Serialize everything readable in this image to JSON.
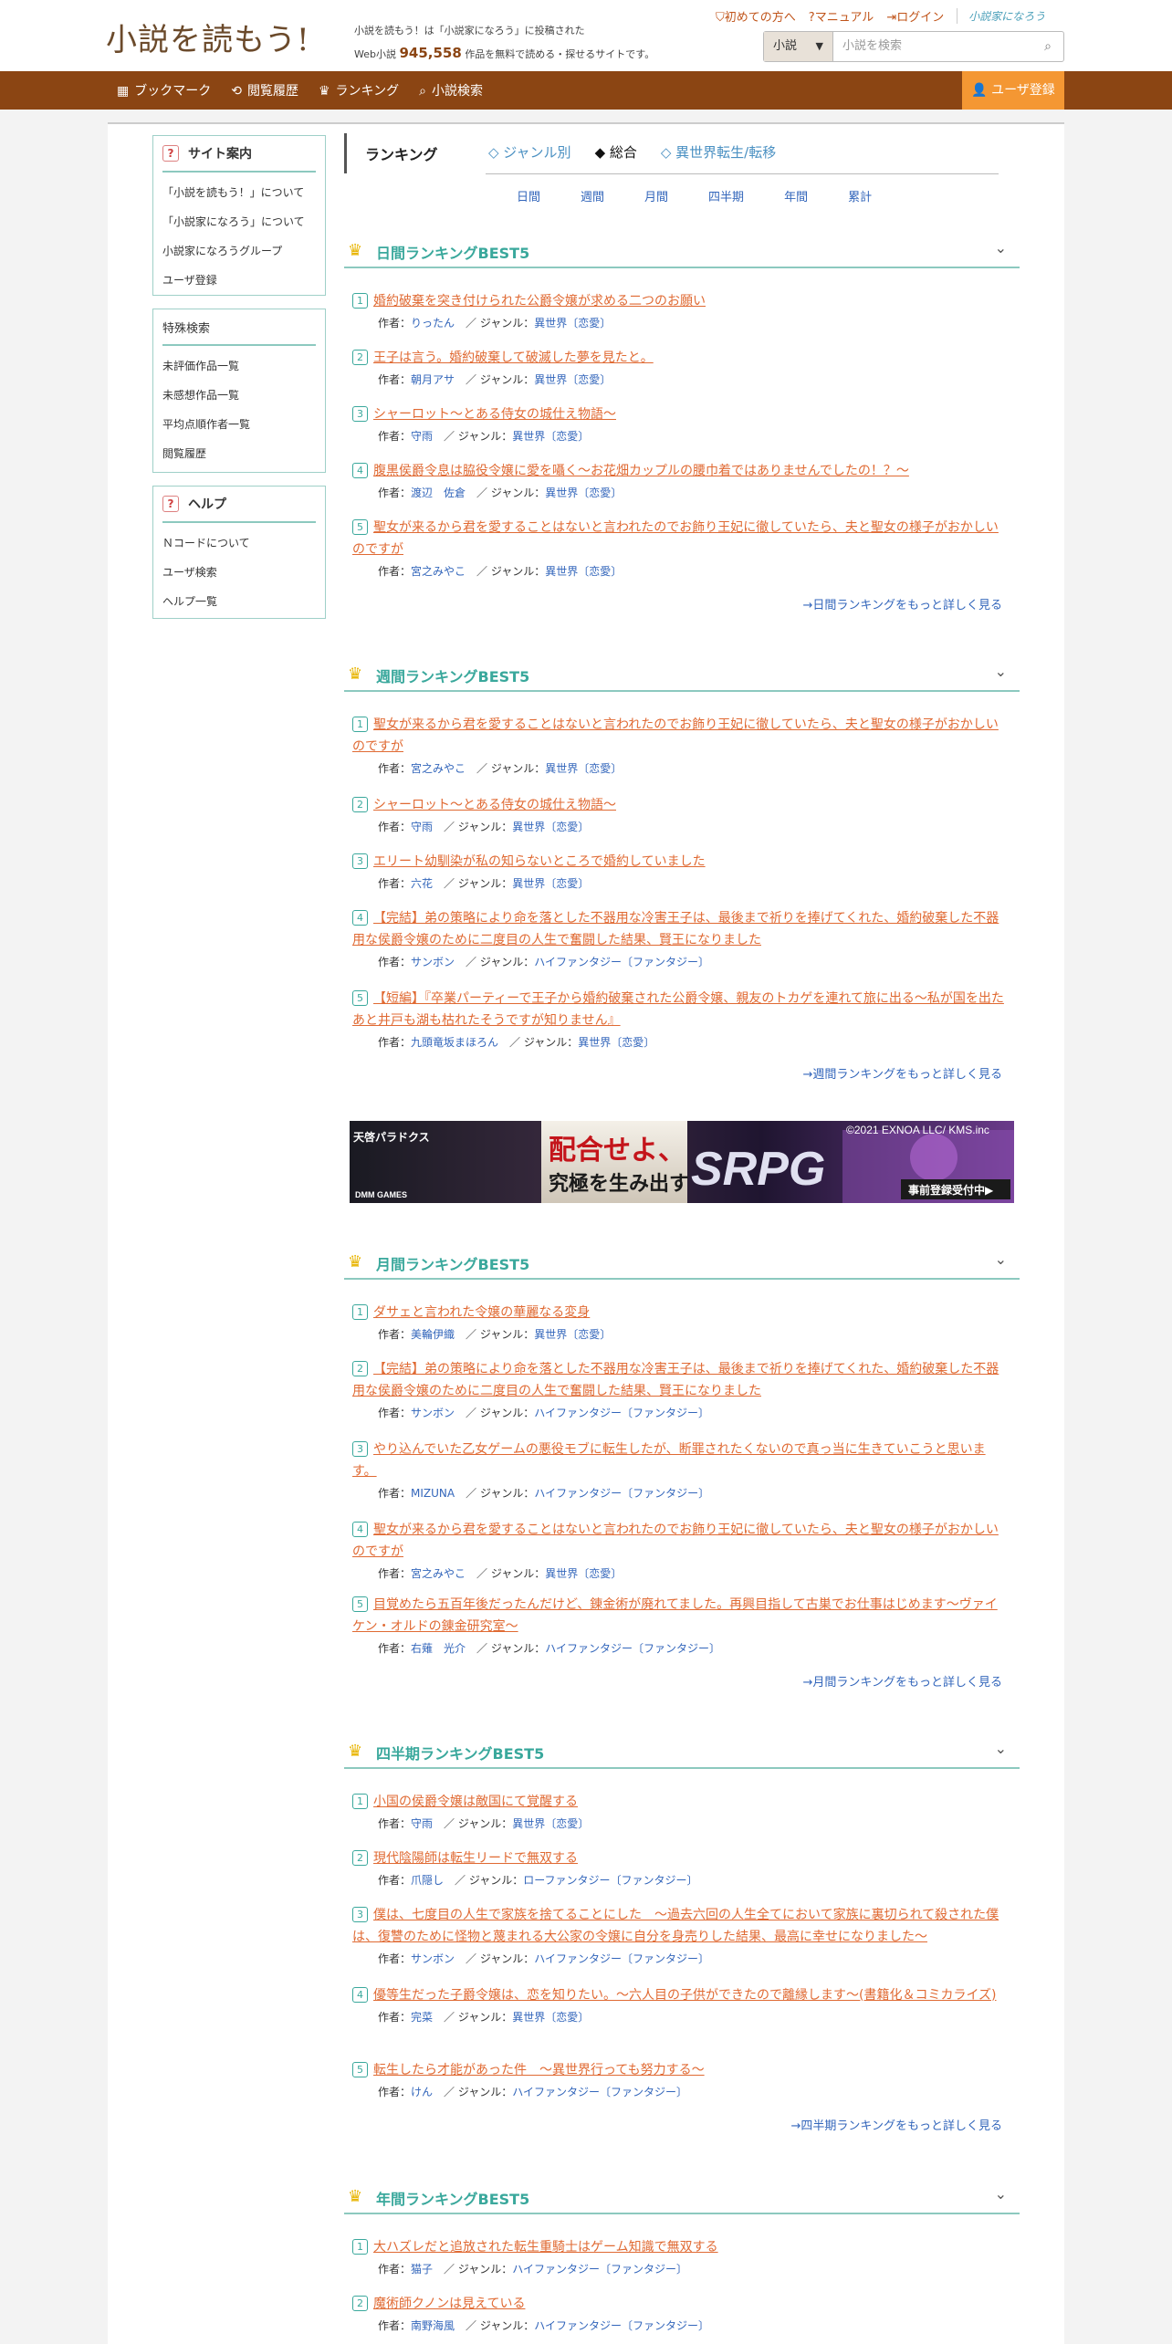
{
  "header": {
    "logo": "小説を読もう!",
    "tagline_line1": "小説を読もう！は「小説家になろう」に投稿された",
    "tagline_pre": "Web小説",
    "tagline_count": "945,558",
    "tagline_post": "作品を無料で読める・探せるサイトです。",
    "links": [
      {
        "icon": "⛉",
        "label": "初めての方へ"
      },
      {
        "icon": "?",
        "label": "マニュアル"
      },
      {
        "icon": "⇥",
        "label": "ログイン"
      }
    ],
    "narou_logo": "小説家になろう",
    "search": {
      "select": "小説",
      "placeholder": "小説を検索"
    }
  },
  "nav": {
    "items": [
      {
        "icon": "▦",
        "label": "ブックマーク"
      },
      {
        "icon": "⟲",
        "label": "閲覧履歴"
      },
      {
        "icon": "♛",
        "label": "ランキング"
      },
      {
        "icon": "⌕",
        "label": "小説検索"
      }
    ],
    "register": "ユーザ登録"
  },
  "sidebar": {
    "guide_title": "サイト案内",
    "guide_items": [
      "「小説を読もう！」について",
      "「小説家になろう」について",
      "小説家になろうグループ",
      "ユーザ登録"
    ],
    "special_title": "特殊検索",
    "special_items": [
      "未評価作品一覧",
      "未感想作品一覧",
      "平均点順作者一覧",
      "閲覧履歴"
    ],
    "help_title": "ヘルプ",
    "help_items": [
      "Ｎコードについて",
      "ユーザ検索",
      "ヘルプ一覧"
    ]
  },
  "main": {
    "title": "ランキング",
    "tabs": [
      "◇ ジャンル別",
      "◆ 総合",
      "◇ 異世界転生/転移"
    ],
    "periods": [
      "日間",
      "週間",
      "月間",
      "四半期",
      "年間",
      "累計"
    ]
  },
  "labels": {
    "author": "作者：",
    "genre": "／ ジャンル："
  },
  "banner": {
    "copyright": "©2021 EXNOA LLC/ KMS.inc",
    "game": "天啓パラドクス",
    "line1": "配合せよ、",
    "line2": "究極を生み出す",
    "srpg": "SRPG",
    "badge": "事前登録受付中▶",
    "brand": "DMM GAMES"
  },
  "rankings": [
    {
      "title": "日間ランキングBEST5",
      "more": "→日間ランキングをもっと詳しく見る",
      "entries": [
        {
          "title": "婚約破棄を突き付けられた公爵令嬢が求める二つのお願い",
          "author": "りったん",
          "genre": "異世界〔恋愛〕"
        },
        {
          "title": "王子は言う。婚約破棄して破滅した夢を見たと。",
          "author": "朝月アサ",
          "genre": "異世界〔恋愛〕"
        },
        {
          "title": "シャーロット〜とある侍女の城仕え物語〜",
          "author": "守雨",
          "genre": "異世界〔恋愛〕"
        },
        {
          "title": "腹黒侯爵令息は脇役令嬢に愛を囁く～お花畑カップルの腰巾着ではありませんでしたの！？～",
          "author": "渡辺　佐倉",
          "genre": "異世界〔恋愛〕"
        },
        {
          "title": "聖女が来るから君を愛することはないと言われたのでお飾り王妃に徹していたら、夫と聖女の様子がおかしいのですが",
          "author": "宮之みやこ",
          "genre": "異世界〔恋愛〕"
        }
      ]
    },
    {
      "title": "週間ランキングBEST5",
      "more": "→週間ランキングをもっと詳しく見る",
      "entries": [
        {
          "title": "聖女が来るから君を愛することはないと言われたのでお飾り王妃に徹していたら、夫と聖女の様子がおかしいのですが",
          "author": "宮之みやこ",
          "genre": "異世界〔恋愛〕"
        },
        {
          "title": "シャーロット〜とある侍女の城仕え物語〜",
          "author": "守雨",
          "genre": "異世界〔恋愛〕"
        },
        {
          "title": "エリート幼馴染が私の知らないところで婚約していました",
          "author": "六花",
          "genre": "異世界〔恋愛〕"
        },
        {
          "title": "【完結】弟の策略により命を落とした不器用な冷害王子は、最後まで祈りを捧げてくれた、婚約破棄した不器用な侯爵令嬢のために二度目の人生で奮闘した結果、賢王になりました",
          "author": "サンボン",
          "genre": "ハイファンタジー〔ファンタジー〕"
        },
        {
          "title": "【短編】『卒業パーティーで王子から婚約破棄された公爵令嬢、親友のトカゲを連れて旅に出る〜私が国を出たあと井戸も湖も枯れたそうですが知りません』",
          "author": "九頭竜坂まほろん",
          "genre": "異世界〔恋愛〕"
        }
      ]
    },
    {
      "title": "月間ランキングBEST5",
      "more": "→月間ランキングをもっと詳しく見る",
      "entries": [
        {
          "title": "ダサェと言われた令嬢の華麗なる変身",
          "author": "美輪伊織",
          "genre": "異世界〔恋愛〕"
        },
        {
          "title": "【完結】弟の策略により命を落とした不器用な冷害王子は、最後まで祈りを捧げてくれた、婚約破棄した不器用な侯爵令嬢のために二度目の人生で奮闘した結果、賢王になりました",
          "author": "サンボン",
          "genre": "ハイファンタジー〔ファンタジー〕"
        },
        {
          "title": "やり込んでいた乙女ゲームの悪役モブに転生したが、断罪されたくないので真っ当に生きていこうと思います。",
          "author": "MIZUNA",
          "genre": "ハイファンタジー〔ファンタジー〕"
        },
        {
          "title": "聖女が来るから君を愛することはないと言われたのでお飾り王妃に徹していたら、夫と聖女の様子がおかしいのですが",
          "author": "宮之みやこ",
          "genre": "異世界〔恋愛〕"
        },
        {
          "title": "目覚めたら五百年後だったんだけど、錬金術が廃れてました。再興目指して古巣でお仕事はじめます〜ヴァイケン・オルドの錬金研究室〜",
          "author": "右薙　光介",
          "genre": "ハイファンタジー〔ファンタジー〕"
        }
      ]
    },
    {
      "title": "四半期ランキングBEST5",
      "more": "→四半期ランキングをもっと詳しく見る",
      "entries": [
        {
          "title": "小国の侯爵令嬢は敵国にて覚醒する",
          "author": "守雨",
          "genre": "異世界〔恋愛〕"
        },
        {
          "title": "現代陰陽師は転生リードで無双する",
          "author": "爪隠し",
          "genre": "ローファンタジー〔ファンタジー〕"
        },
        {
          "title": "僕は、七度目の人生で家族を捨てることにした　～過去六回の人生全てにおいて家族に裏切られて殺された僕は、復讐のために怪物と蔑まれる大公家の令嬢に自分を身売りした結果、最高に幸せになりました～",
          "author": "サンボン",
          "genre": "ハイファンタジー〔ファンタジー〕"
        },
        {
          "title": "優等生だった子爵令嬢は、恋を知りたい。～六人目の子供ができたので離縁します～(書籍化＆コミカライズ)",
          "author": "完菜",
          "genre": "異世界〔恋愛〕"
        },
        {
          "title": "転生したら才能があった件　～異世界行っても努力する～",
          "author": "けん",
          "genre": "ハイファンタジー〔ファンタジー〕"
        }
      ]
    },
    {
      "title": "年間ランキングBEST5",
      "more": "",
      "entries": [
        {
          "title": "大ハズレだと追放された転生重騎士はゲーム知識で無双する",
          "author": "猫子",
          "genre": "ハイファンタジー〔ファンタジー〕"
        },
        {
          "title": "魔術師クノンは見えている",
          "author": "南野海風",
          "genre": "ハイファンタジー〔ファンタジー〕"
        }
      ]
    }
  ]
}
